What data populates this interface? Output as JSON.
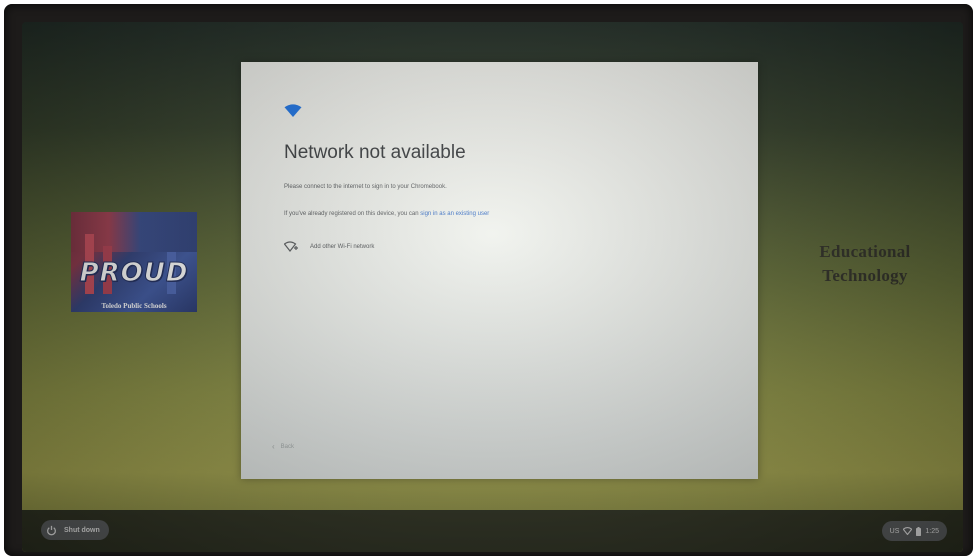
{
  "dialog": {
    "title": "Network not available",
    "message": "Please connect to the internet to sign in to your Chromebook.",
    "registered_prefix": "If you've already registered on this device, you can ",
    "registered_link": "sign in as an existing user",
    "add_wifi_label": "Add other Wi-Fi network",
    "back_label": "Back"
  },
  "wallpaper": {
    "logo_word": "PROUD",
    "logo_subtitle": "Toledo Public Schools",
    "side_text_line1": "Educational",
    "side_text_line2": "Technology"
  },
  "shelf": {
    "shutdown_label": "Shut down",
    "tray_lang": "US",
    "tray_time": "1:25"
  },
  "icons": {
    "wifi": "wifi-icon",
    "add_wifi": "wifi-add-icon",
    "power": "power-icon",
    "battery": "battery-icon"
  },
  "colors": {
    "accent_blue": "#1a73e8",
    "link_blue": "#3d73c9"
  }
}
